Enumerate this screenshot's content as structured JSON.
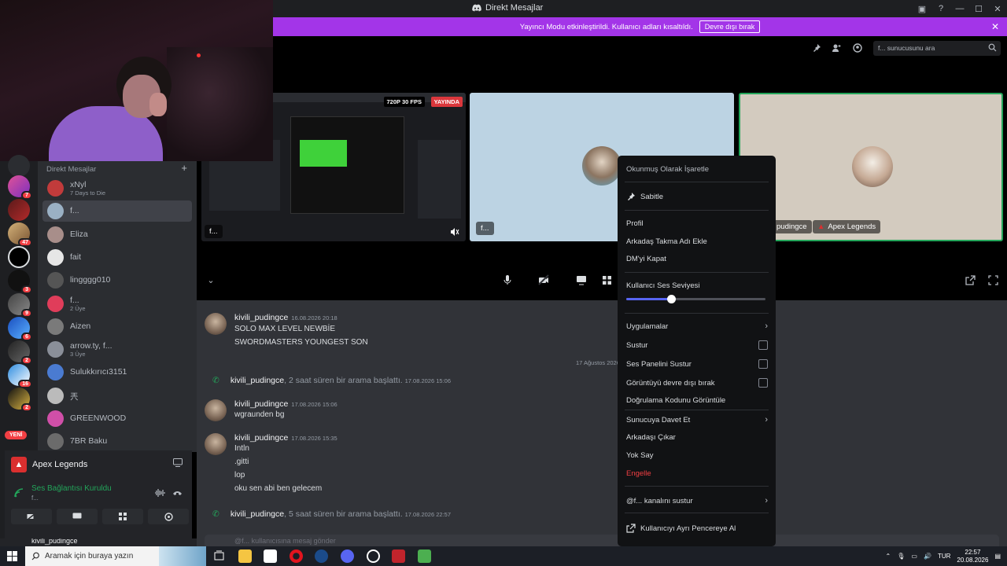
{
  "window": {
    "title": "Direkt Mesajlar"
  },
  "banner": {
    "text": "Yayıncı Modu etkinleştirildi. Kullanıcı adları kısaltıldı.",
    "button": "Devre dışı bırak"
  },
  "header": {
    "search_placeholder": "f... sunucusunu ara"
  },
  "stage": {
    "stream_quality": "720P 30 FPS",
    "live_badge": "YAYINDA",
    "tile1_name": "f...",
    "tile2_name": "f...",
    "tile3_name": "pudingce",
    "tile3_activity": "Apex Legends"
  },
  "servers": [
    {
      "badge": "7"
    },
    {
      "badge": ""
    },
    {
      "badge": "47"
    },
    {
      "badge": ""
    },
    {
      "badge": "3"
    },
    {
      "badge": "9"
    },
    {
      "badge": "6"
    },
    {
      "badge": "2"
    },
    {
      "badge": "16"
    },
    {
      "badge": "2"
    }
  ],
  "new_label": "YENİ",
  "dm_list": {
    "header": "Direkt Mesajlar",
    "items": [
      {
        "name": "xNyl",
        "sub": "7 Days to Die",
        "color": "#c13b3b"
      },
      {
        "name": "f...",
        "sub": "",
        "color": "#9ab0c4"
      },
      {
        "name": "Eliza",
        "sub": "",
        "color": "#a88e8a"
      },
      {
        "name": "fait",
        "sub": "",
        "color": "#e6e6e6"
      },
      {
        "name": "lingggg010",
        "sub": "",
        "color": "#555"
      },
      {
        "name": "f...",
        "sub": "2 Üye",
        "color": "#e03d5a"
      },
      {
        "name": "Aizen",
        "sub": "",
        "color": "#7a7a7a"
      },
      {
        "name": "arrow.ty, f...",
        "sub": "3 Üye",
        "color": "#8a8f99"
      },
      {
        "name": "Sulukkırıcı3151",
        "sub": "",
        "color": "#4a7bd1"
      },
      {
        "name": "兲",
        "sub": "",
        "color": "#bbb"
      },
      {
        "name": "GREENWOOD",
        "sub": "",
        "color": "#d04fa8"
      },
      {
        "name": "7BR Baku",
        "sub": "",
        "color": "#6b6b6b"
      }
    ]
  },
  "voice_panel": {
    "game": "Apex Legends",
    "status": "Ses Bağlantısı Kuruldu",
    "channel": "f..."
  },
  "user_strip": {
    "name": "kivili_pudingce"
  },
  "chat": {
    "date_divider": "17 Ağustos 2026",
    "messages": [
      {
        "author": "kivili_pudingce",
        "time": "16.08.2026 20:18",
        "lines": [
          "SOLO MAX LEVEL NEWBİE",
          "SWORDMASTERS YOUNGEST SON"
        ]
      },
      {
        "author": "kivili_pudingce",
        "time": "17.08.2026 15:06",
        "lines": [
          "wgraunden bg"
        ]
      },
      {
        "author": "kivili_pudingce",
        "time": "17.08.2026 15:35",
        "lines": [
          "Intln",
          ".gitti",
          "lop",
          "oku sen abi ben gelecem"
        ]
      }
    ],
    "calls": [
      {
        "author": "kivili_pudingce",
        "text": ", 2 saat süren bir arama başlattı.",
        "time": "17.08.2026 15:06"
      },
      {
        "author": "kivili_pudingce",
        "text": ", 5 saat süren bir arama başlattı.",
        "time": "17.08.2026 22:57"
      }
    ],
    "input_placeholder": "@f... kullanıcısına mesaj gönder"
  },
  "context_menu": {
    "mark_read": "Okunmuş Olarak İşaretle",
    "pin": "Sabitle",
    "profile": "Profil",
    "add_nickname": "Arkadaş Takma Adı Ekle",
    "close_dm": "DM'yi Kapat",
    "volume_label": "Kullanıcı Ses Seviyesi",
    "volume_fraction": 0.32,
    "apps": "Uygulamalar",
    "mute": "Sustur",
    "mute_soundboard": "Ses Panelini Sustur",
    "disable_video": "Görüntüyü devre dışı bırak",
    "verify_code": "Doğrulama Kodunu Görüntüle",
    "invite_server": "Sunucuya Davet Et",
    "remove_friend": "Arkadaşı Çıkar",
    "ignore": "Yok Say",
    "block": "Engelle",
    "mute_channel": "@f... kanalını sustur",
    "popout": "Kullanıcıyı Ayrı Pencereye Al"
  },
  "taskbar": {
    "search_placeholder": "Aramak için buraya yazın",
    "lang": "TUR",
    "time": "22:57",
    "date": "20.08.2026"
  }
}
